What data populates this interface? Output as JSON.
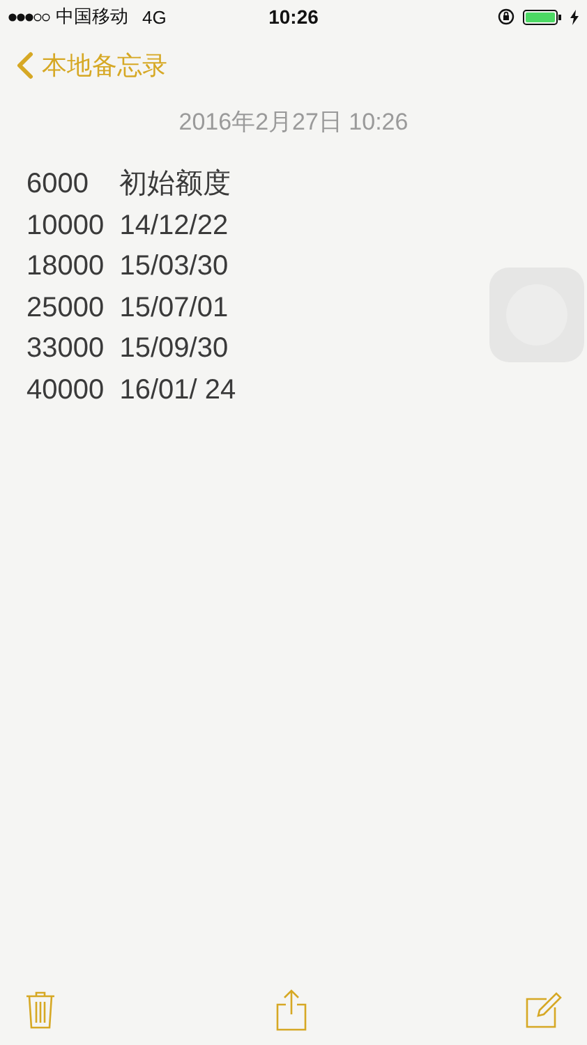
{
  "status_bar": {
    "carrier": "中国移动",
    "network": "4G",
    "time": "10:26"
  },
  "nav": {
    "back_label": "本地备忘录"
  },
  "note": {
    "date": "2016年2月27日 10:26",
    "lines": [
      "6000    初始额度",
      "10000  14/12/22",
      "18000  15/03/30",
      "25000  15/07/01",
      "33000  15/09/30",
      "40000  16/01/ 24"
    ]
  }
}
